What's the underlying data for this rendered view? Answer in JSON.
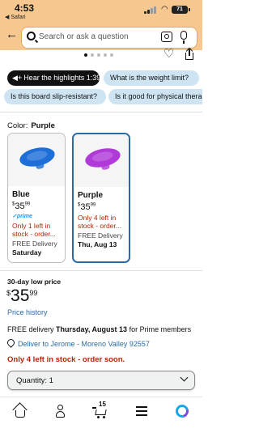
{
  "status_bar": {
    "time": "4:53",
    "back_app": "◀ Safari",
    "battery": "71"
  },
  "search": {
    "placeholder": "Search or ask a question"
  },
  "chips": {
    "row1": [
      {
        "label": "Hear the highlights 1:39",
        "kind": "audio"
      },
      {
        "label": "What is the weight limit?"
      }
    ],
    "row2": [
      {
        "label": "Is this board slip-resistant?"
      },
      {
        "label": "Is it good for physical thera"
      }
    ]
  },
  "color": {
    "label": "Color:",
    "value": "Purple"
  },
  "variants": [
    {
      "name": "Blue",
      "price_currency": "$",
      "price_whole": "35",
      "price_frac": "99",
      "prime": "✓prime",
      "stock_line1": "Only 1 left in",
      "stock_line2": "stock - order...",
      "delivery": "FREE Delivery",
      "delivery_date": "Saturday",
      "color": "#1e6ed8",
      "selected": false
    },
    {
      "name": "Purple",
      "price_currency": "$",
      "price_whole": "35",
      "price_frac": "99",
      "stock_line1": "Only 4 left in",
      "stock_line2": "stock - order...",
      "delivery": "FREE Delivery",
      "delivery_date": "Thu, Aug 13",
      "color": "#b03ad8",
      "selected": true
    }
  ],
  "pricing": {
    "badge": "30-day low price",
    "currency": "$",
    "whole": "35",
    "frac": "99",
    "history_link": "Price history"
  },
  "delivery": {
    "prefix": "FREE delivery",
    "date": "Thursday, August 13",
    "suffix": "for Prime members",
    "deliver_to": "Deliver to Jerome - Moreno Valley 92557"
  },
  "stock_notice": "Only 4 left in stock - order soon.",
  "quantity": {
    "label": "Quantity: 1"
  },
  "nav": {
    "cart_count": "15"
  },
  "colors": {
    "header": "#f6c78f",
    "link": "#2a6aa6",
    "alert": "#b12704",
    "chip": "#cfe4f2"
  }
}
